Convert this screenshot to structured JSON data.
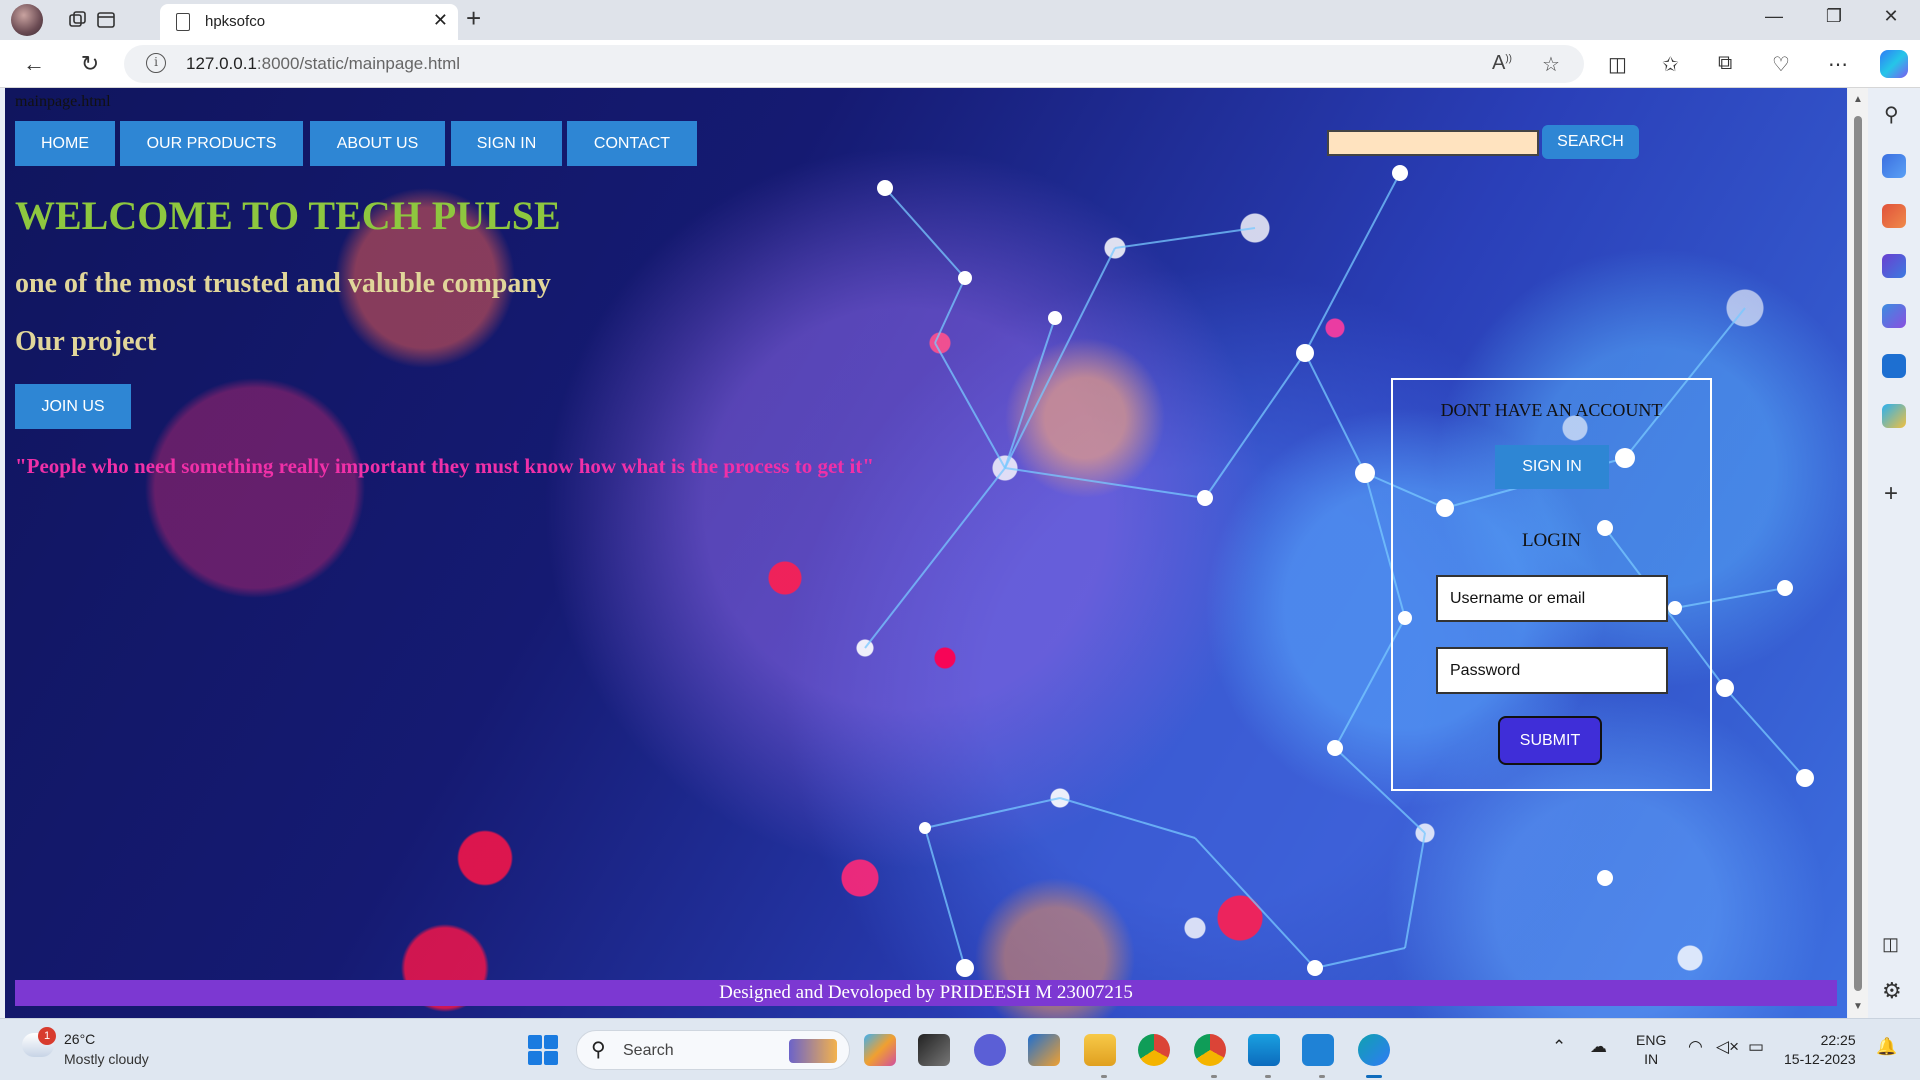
{
  "browser": {
    "tab_title": "hpksofco",
    "url_host": "127.0.0.1",
    "url_rest": ":8000/static/mainpage.html"
  },
  "page": {
    "file_label": "mainpage.html",
    "nav": [
      "HOME",
      "OUR PRODUCTS",
      "ABOUT US",
      "SIGN IN",
      "CONTACT"
    ],
    "search": {
      "value": "",
      "button": "SEARCH"
    },
    "welcome": "WELCOME TO TECH PULSE",
    "subheading": "one of the most trusted and valuble company",
    "project": "Our project",
    "join_button": "JOIN US",
    "quote": "\"People who need something really important they must know how what is the process to get it\"",
    "login_panel": {
      "no_account": "DONT HAVE AN ACCOUNT",
      "signin_button": "SIGN IN",
      "login_heading": "LOGIN",
      "username_placeholder": "Username or email",
      "password_placeholder": "Password",
      "submit_button": "SUBMIT"
    },
    "footer": "Designed and Devoloped by PRIDEESH M 23007215"
  },
  "taskbar": {
    "weather_badge": "1",
    "temperature": "26°C",
    "condition": "Mostly cloudy",
    "search_label": "Search",
    "lang_top": "ENG",
    "lang_bottom": "IN",
    "time": "22:25",
    "date": "15-12-2023"
  },
  "colors": {
    "nav_button": "#2e86d4",
    "welcome_text": "#8ec73f",
    "subheading_text": "#e1d69a",
    "quote_text": "#f030a8",
    "submit_button": "#3f2ed8",
    "footer_bar": "#7c38d2",
    "search_input_bg": "#ffe3bf"
  },
  "icons": [
    "profile-avatar",
    "workspaces-icon",
    "tab-actions-icon",
    "page-icon",
    "close-icon",
    "new-tab-icon",
    "minimize-icon",
    "restore-icon",
    "window-close-icon",
    "back-icon",
    "refresh-icon",
    "info-icon",
    "read-aloud-icon",
    "favorite-star-icon",
    "split-screen-icon",
    "favorites-icon",
    "collections-icon",
    "browser-essentials-icon",
    "more-icon",
    "copilot-icon",
    "sidebar-search-icon",
    "shopping-icon",
    "tools-icon",
    "games-icon",
    "microsoft365-icon",
    "outlook-icon",
    "drop-icon",
    "add-icon",
    "sidebar-toggle-icon",
    "settings-icon",
    "weather-icon",
    "start-icon",
    "search-icon"
  ]
}
